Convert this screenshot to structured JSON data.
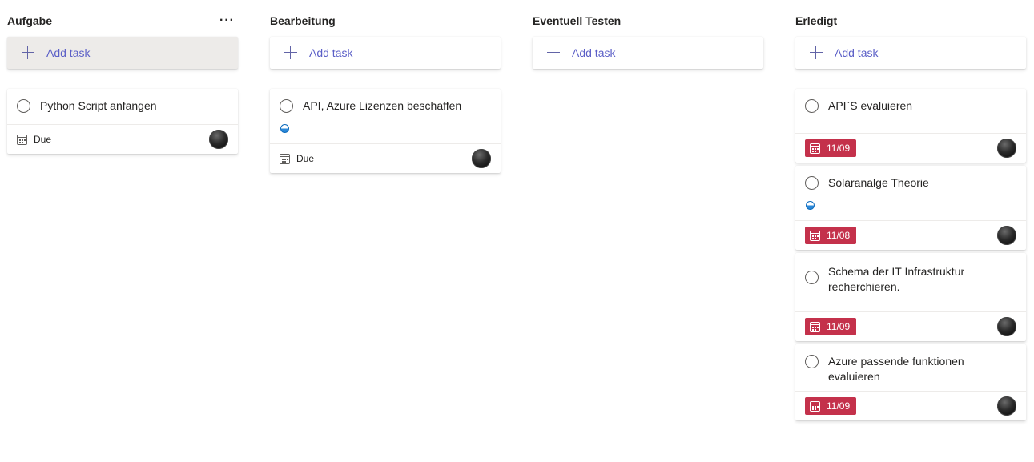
{
  "board": {
    "columns": [
      {
        "title": "Aufgabe",
        "add_task": "Add task",
        "more": "···",
        "cards": [
          {
            "title": "Python Script anfangen",
            "due": "Due",
            "late": false,
            "progress": false
          }
        ]
      },
      {
        "title": "Bearbeitung",
        "add_task": "Add task",
        "cards": [
          {
            "title": "API, Azure Lizenzen beschaffen",
            "due": "Due",
            "late": false,
            "progress": true
          }
        ]
      },
      {
        "title": "Eventuell Testen",
        "add_task": "Add task",
        "cards": []
      },
      {
        "title": "Erledigt",
        "add_task": "Add task",
        "cards": [
          {
            "title": "API`S evaluieren",
            "due": "11/09",
            "late": true,
            "progress": false
          },
          {
            "title": "Solaranalge Theorie",
            "due": "11/08",
            "late": true,
            "progress": true
          },
          {
            "title": "Schema der IT Infrastruktur recherchieren.",
            "due": "11/09",
            "late": true,
            "progress": false
          },
          {
            "title": "Azure passende funktionen evaluieren",
            "due": "11/09",
            "late": true,
            "progress": false
          }
        ]
      }
    ]
  },
  "colors": {
    "accent": "#6264a7",
    "late_badge": "#c4314b",
    "progress": "#2b88d8"
  }
}
